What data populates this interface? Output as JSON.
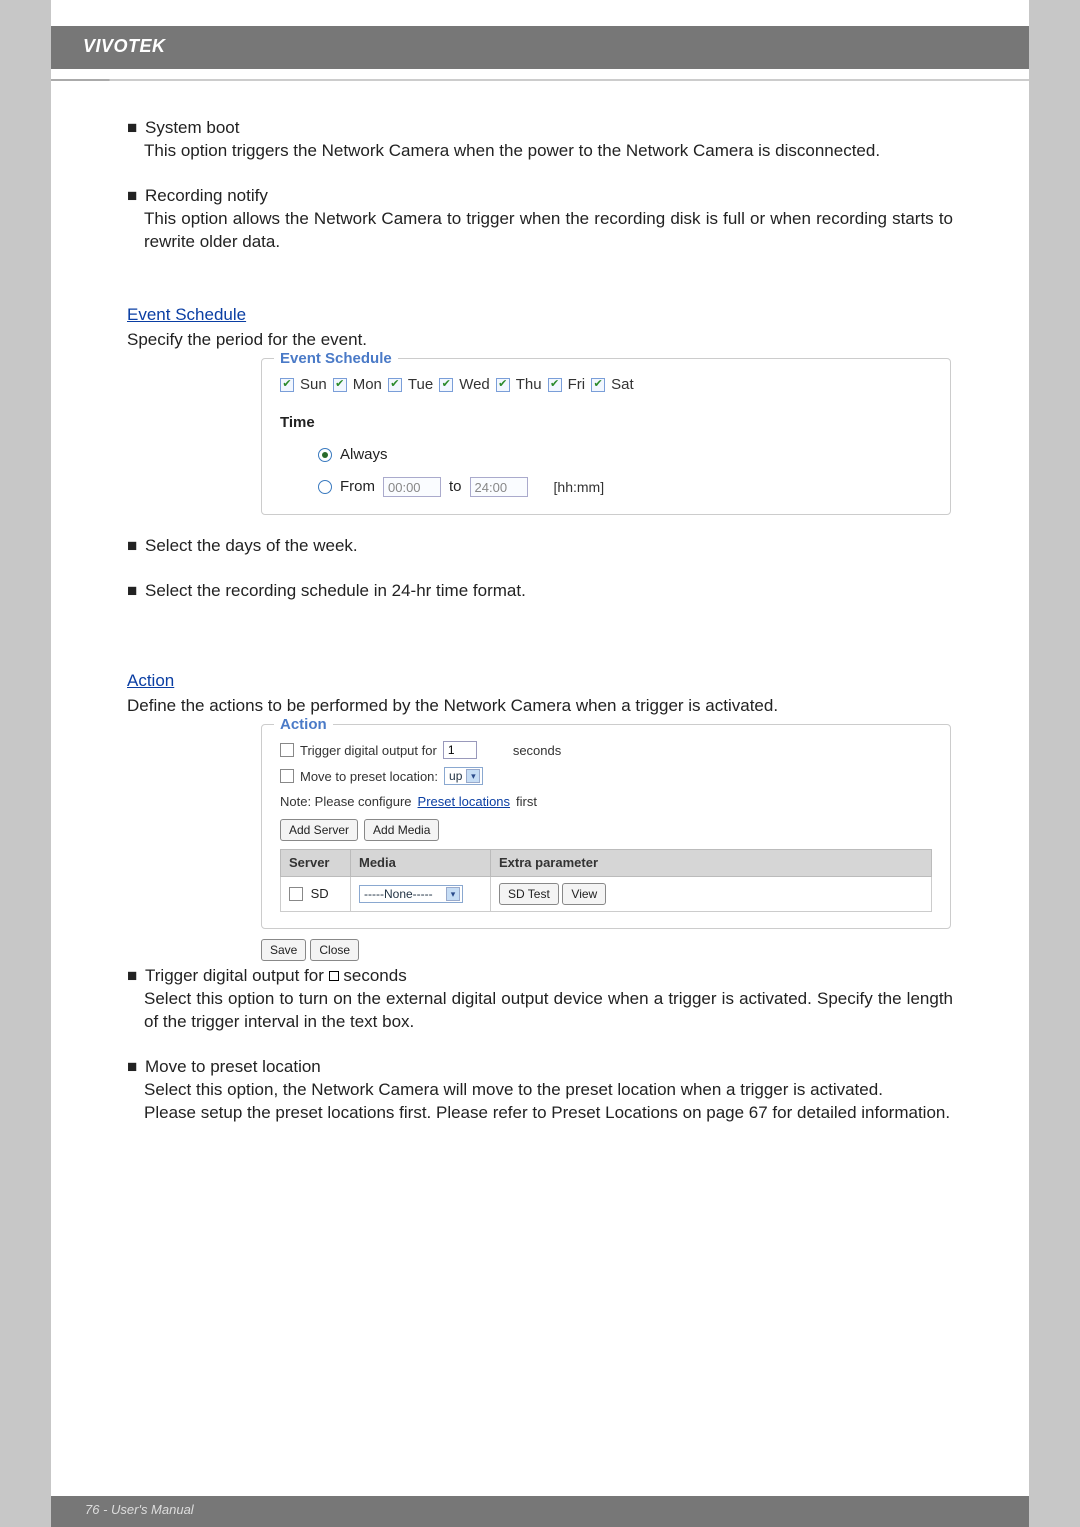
{
  "brand": "VIVOTEK",
  "bullets": {
    "systemBoot": {
      "title": "System boot",
      "desc": "This option triggers the Network Camera when the power to the Network Camera is disconnected."
    },
    "recordingNotify": {
      "title": "Recording notify",
      "desc": "This option allows the Network Camera to trigger when the recording disk is full or when recording starts to rewrite older data."
    }
  },
  "eventSchedule": {
    "heading": "Event Schedule",
    "intro": "Specify the period for the event.",
    "legend": "Event Schedule",
    "days": [
      "Sun",
      "Mon",
      "Tue",
      "Wed",
      "Thu",
      "Fri",
      "Sat"
    ],
    "timeLabel": "Time",
    "always": "Always",
    "from": "From",
    "fromVal": "00:00",
    "toLabel": "to",
    "toVal": "24:00",
    "hint": "[hh:mm]",
    "bullet1": "Select the days of the week.",
    "bullet2": "Select the recording schedule in 24-hr time format."
  },
  "action": {
    "heading": "Action",
    "intro": "Define the actions to be performed by the Network Camera when a trigger is activated.",
    "legend": "Action",
    "triggerOutputLabelA": "Trigger digital output for",
    "triggerOutputVal": "1",
    "triggerOutputLabelB": "seconds",
    "moveLabel": "Move to preset location:",
    "moveVal": "up",
    "noteA": "Note: Please configure ",
    "noteLink": "Preset locations",
    "noteB": " first",
    "addServer": "Add Server",
    "addMedia": "Add Media",
    "colServer": "Server",
    "colMedia": "Media",
    "colExtra": "Extra parameter",
    "rowServer": "SD",
    "rowMedia": "-----None-----",
    "btnSdTest": "SD Test",
    "btnView": "View",
    "btnSave": "Save",
    "btnClose": "Close",
    "triggerBulletA": "Trigger digital output for ",
    "triggerBulletB": " seconds",
    "triggerDesc": "Select this option to turn on the external digital output device when a trigger is activated. Specify the length of the trigger interval in the text box.",
    "moveBulletTitle": "Move to preset location",
    "moveDescA": "Select this option, the Network Camera will move to the preset location when a trigger is activated.",
    "moveDescB": "Please setup the preset locations first. Please refer to Preset Locations on page 67 for detailed information."
  },
  "footer": "76 - User's Manual"
}
